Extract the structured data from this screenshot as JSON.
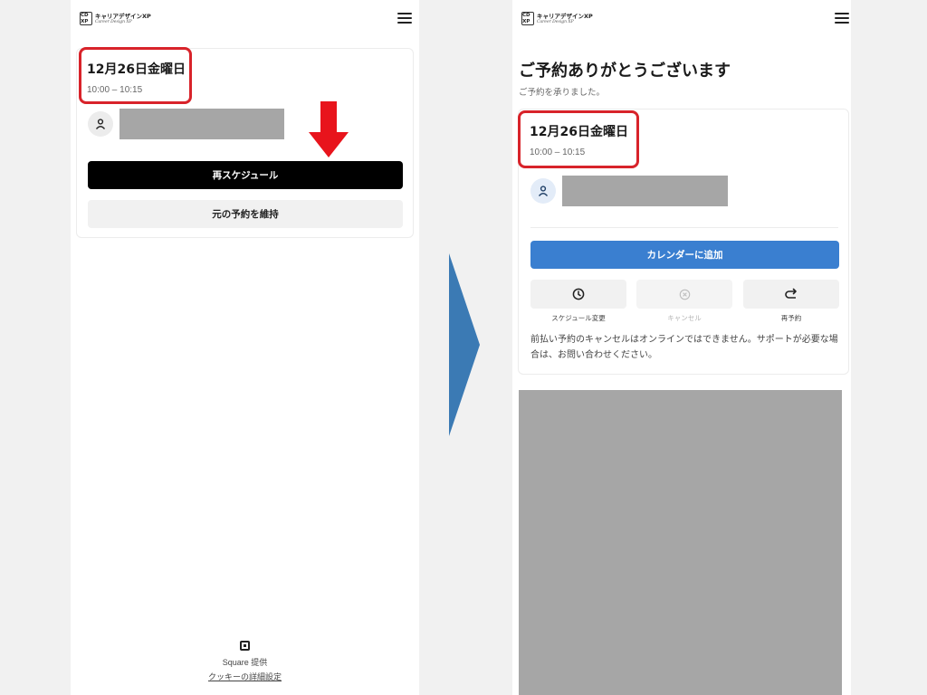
{
  "colors": {
    "red_highlight": "#d8232a",
    "arrow_red": "#e8141c",
    "chevron_blue": "#3b7ab4",
    "primary_blue": "#3a7fd0"
  },
  "logo": {
    "mark": [
      "CD",
      "XP"
    ],
    "name": "キャリアデザインXP",
    "sub": "Career Design XP"
  },
  "left": {
    "date": "12月26日金曜日",
    "time": "10:00 – 10:15",
    "reschedule_label": "再スケジュール",
    "keep_label": "元の予約を維持",
    "footer_provider": "Square 提供",
    "footer_cookie": "クッキーの詳細設定"
  },
  "right": {
    "title": "ご予約ありがとうございます",
    "subtitle": "ご予約を承りました。",
    "date": "12月26日金曜日",
    "time": "10:00 – 10:15",
    "calendar_label": "カレンダーに追加",
    "actions": [
      {
        "label": "スケジュール変更",
        "icon": "clock-icon",
        "enabled": true
      },
      {
        "label": "キャンセル",
        "icon": "cancel-circle-icon",
        "enabled": false
      },
      {
        "label": "再予約",
        "icon": "rebook-arrow-icon",
        "enabled": true
      }
    ],
    "notice": "前払い予約のキャンセルはオンラインではできません。サポートが必要な場合は、お問い合わせください。"
  }
}
